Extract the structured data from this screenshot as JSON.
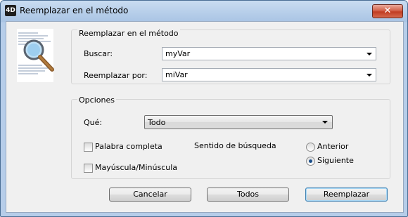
{
  "window": {
    "title": "Reemplazar en el método",
    "app_icon": "4D",
    "close_label": "✕"
  },
  "replace_group": {
    "title": "Reemplazar en el método",
    "find_label": "Buscar:",
    "find_value": "myVar",
    "replace_label": "Reemplazar por:",
    "replace_value": "miVar"
  },
  "options_group": {
    "title": "Opciones",
    "what_label": "Qué:",
    "what_selected": "Todo",
    "whole_word_label": "Palabra completa",
    "whole_word_checked": false,
    "case_label": "Mayúscula/Minúscula",
    "case_checked": false,
    "direction_label": "Sentido de búsqueda",
    "previous_label": "Anterior",
    "next_label": "Siguiente",
    "direction_selected": "Siguiente"
  },
  "buttons": {
    "cancel": "Cancelar",
    "all": "Todos",
    "replace": "Reemplazar"
  }
}
